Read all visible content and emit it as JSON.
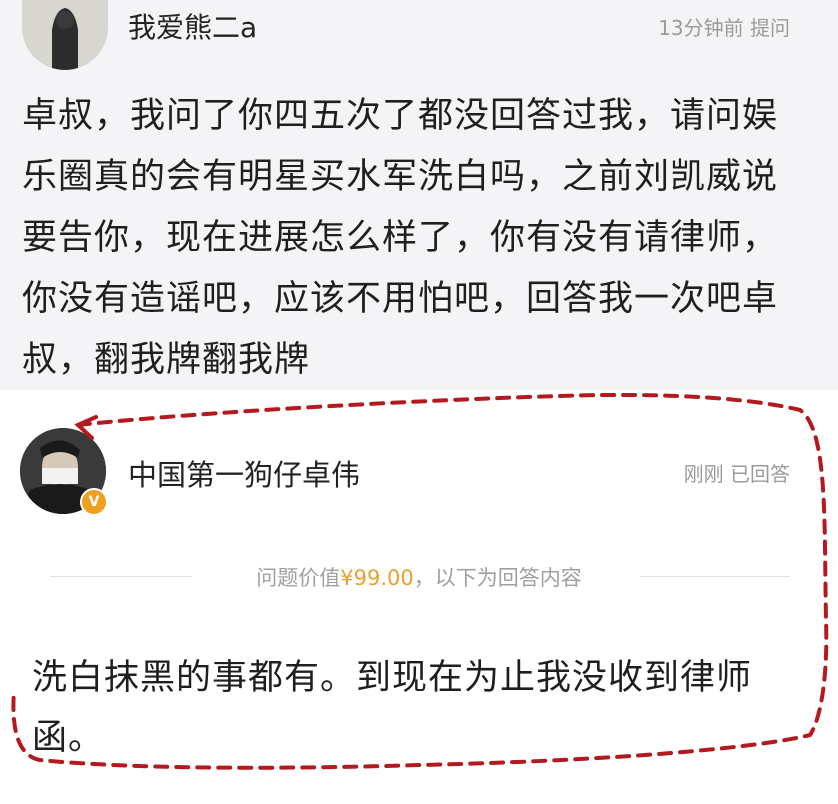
{
  "question": {
    "author": "我爱熊二a",
    "time": "13分钟前",
    "type": "提问",
    "text": "卓叔，我问了你四五次了都没回答过我，请问娱乐圈真的会有明星买水军洗白吗，之前刘凯威说要告你，现在进展怎么样了，你有没有请律师，你没有造谣吧，应该不用怕吧，回答我一次吧卓叔，翻我牌翻我牌"
  },
  "answer": {
    "author": "中国第一狗仔卓伟",
    "time": "刚刚",
    "status": "已回答",
    "price_prefix": "问题价值",
    "price": "¥99.00",
    "price_suffix": "，以下为回答内容",
    "text": "洗白抹黑的事都有。到现在为止我没收到律师函。",
    "verified_badge": "V"
  },
  "colors": {
    "dashed_border": "#b3191f",
    "price": "#e8a030",
    "meta": "#9a9a9a"
  },
  "icons": {
    "verified": "verified-badge-icon"
  }
}
